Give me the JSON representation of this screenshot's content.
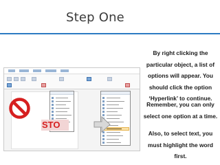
{
  "slide": {
    "title": "Step One",
    "accent_color": "#2c7bc2",
    "instructions": {
      "para1": [
        "By right clicking the",
        "particular object, a list of",
        "options will appear. You",
        "should click the option",
        "‘Hyperlink’ to continue."
      ],
      "para2": [
        "Remember, you can only",
        "select one option at a time."
      ],
      "para3": [
        "Also, to select text, you",
        "must highlight the word",
        "first."
      ]
    }
  },
  "screenshot": {
    "stop_sign_text": "STO",
    "stop_color": "#d61f1f",
    "highlight_color": "#fbe2a7",
    "icons": [
      "prohibition-icon",
      "arrow-icon"
    ]
  }
}
